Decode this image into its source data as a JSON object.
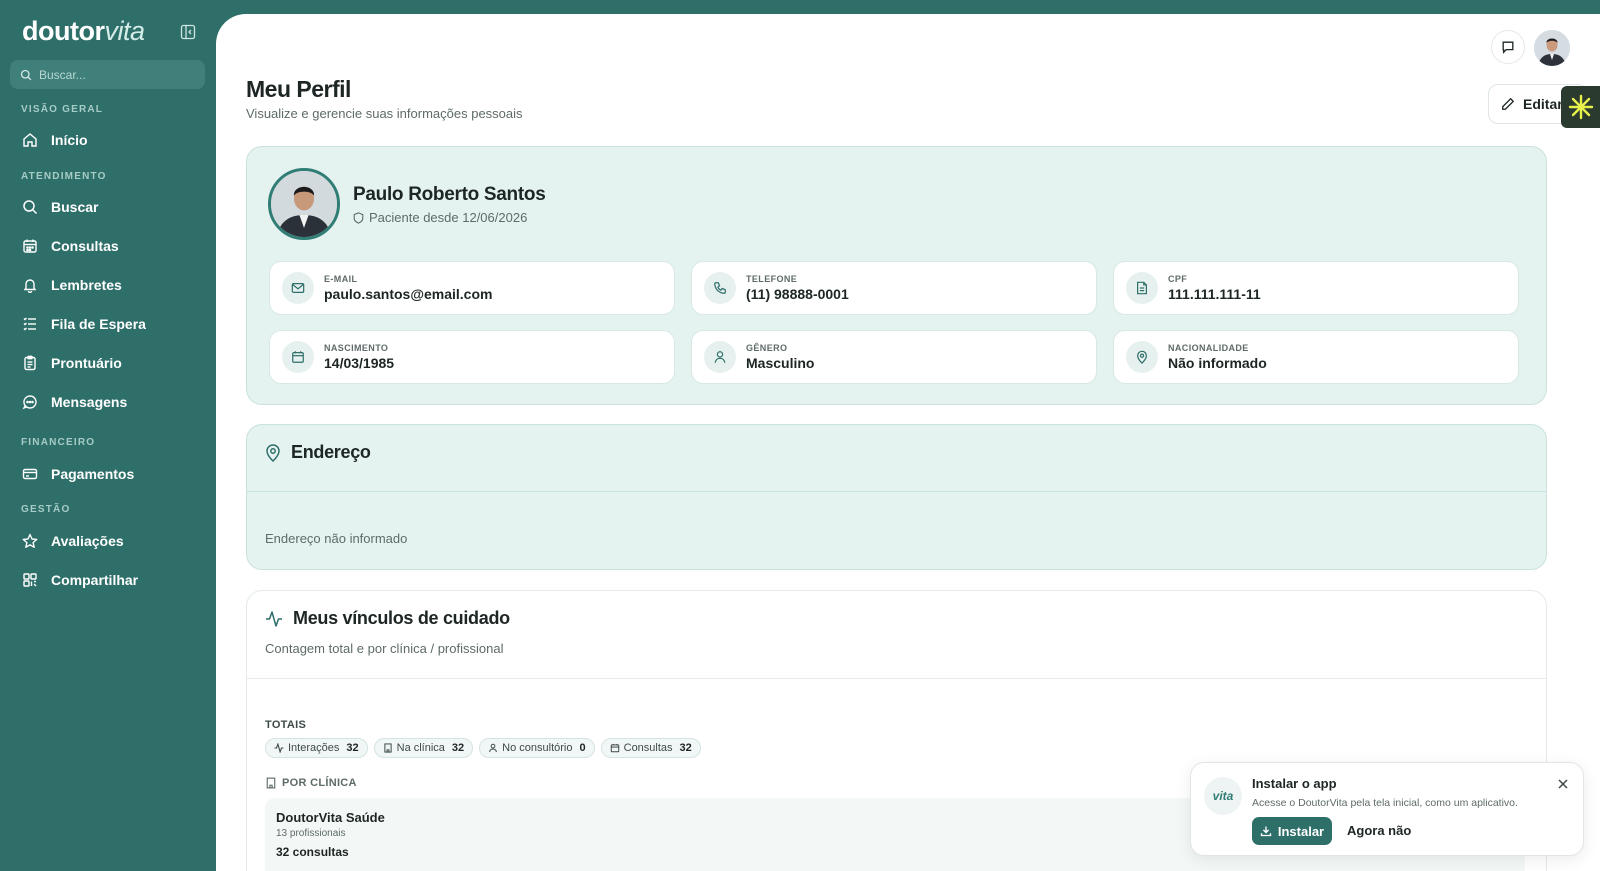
{
  "brand": {
    "part1": "doutor",
    "part2": "vita"
  },
  "search": {
    "placeholder": "Buscar..."
  },
  "sidebar": {
    "sections": [
      {
        "label": "VISÃO GERAL"
      },
      {
        "label": "ATENDIMENTO"
      },
      {
        "label": "FINANCEIRO"
      },
      {
        "label": "GESTÃO"
      }
    ],
    "items": [
      {
        "label": "Início",
        "icon": "home-icon"
      },
      {
        "label": "Buscar",
        "icon": "search-icon"
      },
      {
        "label": "Consultas",
        "icon": "calendar-icon"
      },
      {
        "label": "Lembretes",
        "icon": "bell-icon"
      },
      {
        "label": "Fila de Espera",
        "icon": "list-icon"
      },
      {
        "label": "Prontuário",
        "icon": "clipboard-icon"
      },
      {
        "label": "Mensagens",
        "icon": "chat-icon"
      },
      {
        "label": "Pagamentos",
        "icon": "card-icon"
      },
      {
        "label": "Avaliações",
        "icon": "star-icon"
      },
      {
        "label": "Compartilhar",
        "icon": "qr-icon"
      }
    ]
  },
  "header": {
    "title": "Meu Perfil",
    "subtitle": "Visualize e gerencie suas informações pessoais",
    "edit_label": "Editar"
  },
  "profile": {
    "name": "Paulo Roberto Santos",
    "since": "Paciente desde 12/06/2026",
    "fields": [
      {
        "label": "E-MAIL",
        "value": "paulo.santos@email.com",
        "icon": "mail-icon"
      },
      {
        "label": "TELEFONE",
        "value": "(11) 98888-0001",
        "icon": "phone-icon"
      },
      {
        "label": "CPF",
        "value": "111.111.111-11",
        "icon": "document-icon"
      },
      {
        "label": "NASCIMENTO",
        "value": "14/03/1985",
        "icon": "calendar-icon"
      },
      {
        "label": "GÊNERO",
        "value": "Masculino",
        "icon": "user-icon"
      },
      {
        "label": "NACIONALIDADE",
        "value": "Não informado",
        "icon": "location-icon"
      }
    ]
  },
  "address": {
    "title": "Endereço",
    "empty": "Endereço não informado"
  },
  "bonds": {
    "title": "Meus vínculos de cuidado",
    "subtitle": "Contagem total e por clínica / profissional",
    "totals_label": "TOTAIS",
    "chips": [
      {
        "label": "Interações",
        "count": "32"
      },
      {
        "label": "Na clínica",
        "count": "32"
      },
      {
        "label": "No consultório",
        "count": "0"
      },
      {
        "label": "Consultas",
        "count": "32"
      }
    ],
    "by_clinic_label": "POR CLÍNICA",
    "clinic": {
      "name": "DoutorVita Saúde",
      "professionals": "13 profissionais",
      "consultations": "32 consultas"
    }
  },
  "install": {
    "logo": "vita",
    "title": "Instalar o app",
    "description": "Acesse o DoutorVita pela tela inicial, como um aplicativo.",
    "install_label": "Instalar",
    "later_label": "Agora não"
  }
}
